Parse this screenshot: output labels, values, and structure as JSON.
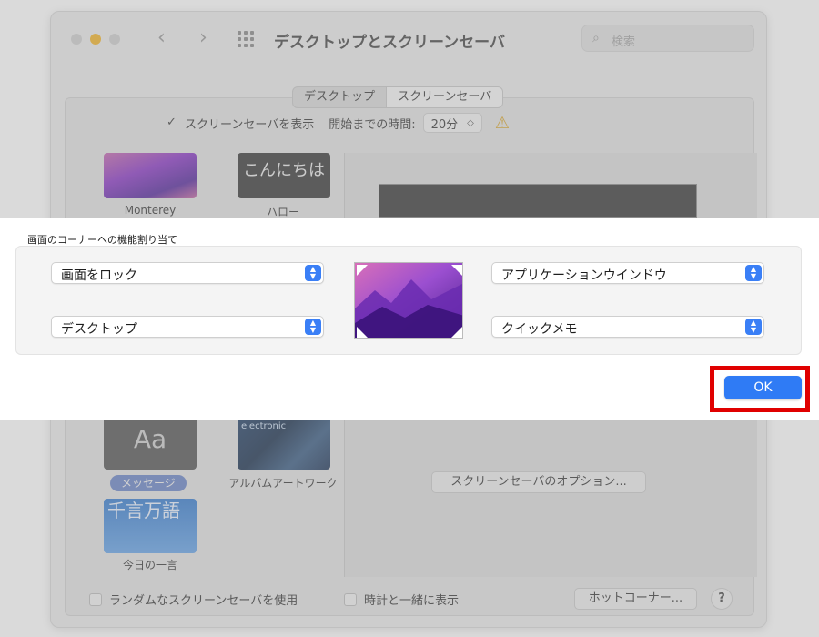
{
  "window": {
    "title": "デスクトップとスクリーンセーバ",
    "search_placeholder": "検索",
    "tabs": [
      "デスクトップ",
      "スクリーンセーバ"
    ],
    "active_tab": "スクリーンセーバ"
  },
  "screensaver": {
    "show_label": "スクリーンセーバを表示",
    "show_checked": true,
    "start_time_label": "開始までの時間:",
    "start_time_value": "20分",
    "options_button": "スクリーンセーバのオプション...",
    "items": [
      {
        "name": "Monterey",
        "thumb_text": ""
      },
      {
        "name": "ハロー",
        "thumb_text": "こんにちは"
      },
      {
        "name": "メッセージ",
        "thumb_text": "Aa",
        "selected": true
      },
      {
        "name": "アルバムアートワーク",
        "thumb_text": "electronic"
      },
      {
        "name": "今日の一言",
        "thumb_text": "千言万語"
      }
    ]
  },
  "bottom": {
    "random_label": "ランダムなスクリーンセーバを使用",
    "clock_label": "時計と一緒に表示",
    "hot_corners_button": "ホットコーナー...",
    "help_button": "?"
  },
  "sheet": {
    "title": "画面のコーナーへの機能割り当て",
    "corners": {
      "top_left": "画面をロック",
      "bottom_left": "デスクトップ",
      "top_right": "アプリケーションウインドウ",
      "bottom_right": "クイックメモ"
    },
    "ok_button": "OK"
  },
  "colors": {
    "accent": "#2f7bf5",
    "highlight_box": "#e00000",
    "warning": "#d9a62b"
  }
}
